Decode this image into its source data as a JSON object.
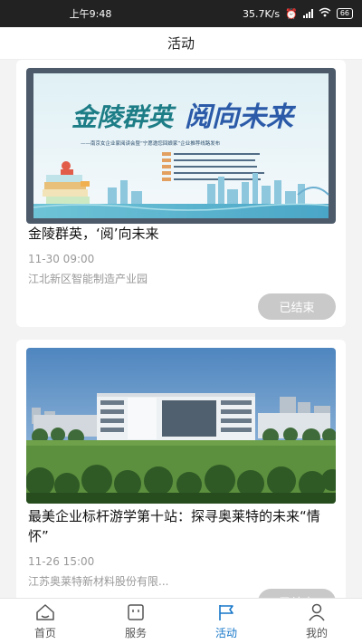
{
  "status": {
    "time": "上午9:48",
    "speed": "35.7K/s",
    "battery": "66"
  },
  "header": {
    "title": "活动"
  },
  "activities": [
    {
      "title": "金陵群英，‘阅’向未来",
      "date": "11-30 09:00",
      "location": "江北新区智能制造产业园",
      "status": "已结束",
      "banner": {
        "headline_a": "金陵群英",
        "headline_b": "阅向未来",
        "subtitle": "——南京女企业家阅读会暨“宁愿邀您回娘家”企业推荐线路发布"
      }
    },
    {
      "title": "最美企业标杆游学第十站：探寻奥莱特的未来“情怀”",
      "date": "11-26 15:00",
      "location": "江苏奥莱特新材料股份有限...",
      "status": "已结束"
    }
  ],
  "tabs": [
    {
      "label": "首页",
      "icon": "home-icon",
      "active": false
    },
    {
      "label": "服务",
      "icon": "service-icon",
      "active": false
    },
    {
      "label": "活动",
      "icon": "flag-icon",
      "active": true
    },
    {
      "label": "我的",
      "icon": "person-icon",
      "active": false
    }
  ],
  "colors": {
    "accent": "#1677c9",
    "ended_button": "#c9c9c9"
  }
}
